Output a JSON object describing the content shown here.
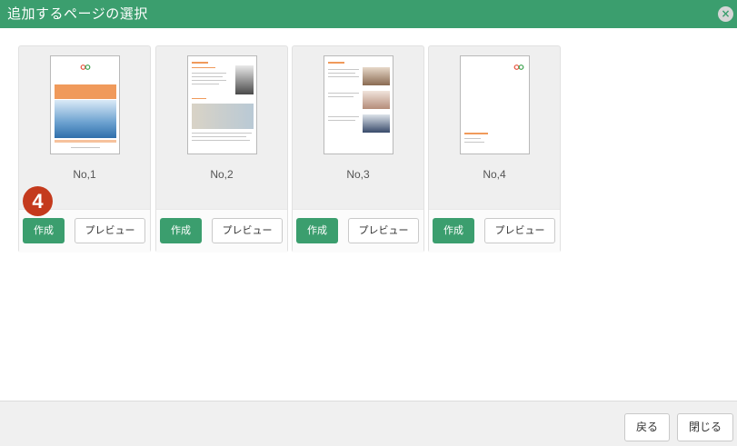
{
  "dialog": {
    "title": "追加するページの選択",
    "close_icon": "×"
  },
  "step_badge": "4",
  "cards": [
    {
      "label": "No,1",
      "create_label": "作成",
      "preview_label": "プレビュー"
    },
    {
      "label": "No,2",
      "create_label": "作成",
      "preview_label": "プレビュー"
    },
    {
      "label": "No,3",
      "create_label": "作成",
      "preview_label": "プレビュー"
    },
    {
      "label": "No,4",
      "create_label": "作成",
      "preview_label": "プレビュー"
    }
  ],
  "footer": {
    "back_label": "戻る",
    "close_label": "閉じる"
  },
  "colors": {
    "accent": "#3b9e6e",
    "badge": "#c43a1d",
    "thumb_accent": "#f09a5b"
  }
}
